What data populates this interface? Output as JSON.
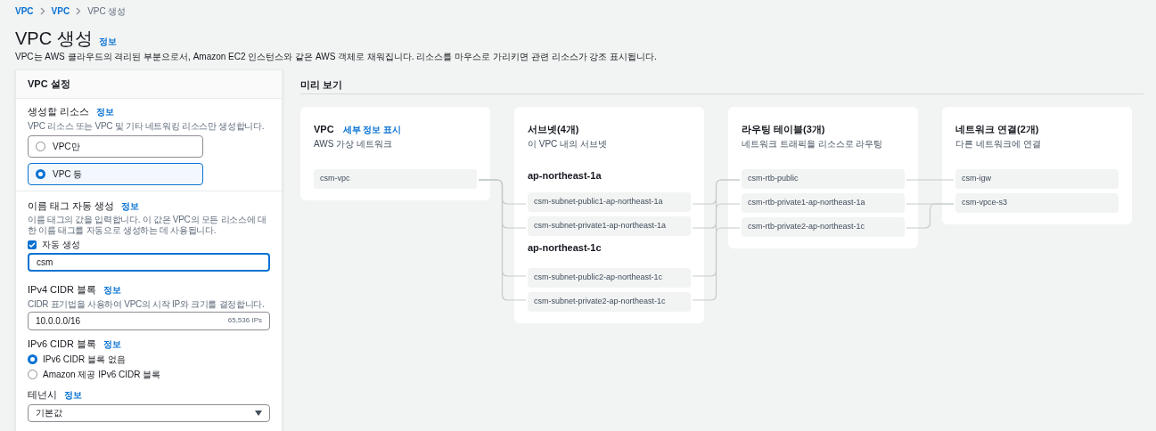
{
  "breadcrumbs": [
    {
      "label": "VPC",
      "link": true
    },
    {
      "label": "VPC",
      "link": true
    },
    {
      "label": "VPC 생성",
      "link": false
    }
  ],
  "page": {
    "title": "VPC 생성",
    "info": "정보",
    "description": "VPC는 AWS 클라우드의 격리된 부분으로서, Amazon EC2 인스턴스와 같은 AWS 객체로 채워집니다. 리소스를 마우스로 가리키면 관련 리소스가 강조 표시됩니다."
  },
  "settings": {
    "title": "VPC 설정",
    "sections": [
      {
        "kind": "radio_cards",
        "label": "생성할 리소스",
        "info": "정보",
        "description": "VPC 리소스 또는 VPC 및 기타 네트워킹 리소스만 생성합니다.",
        "options": [
          {
            "label": "VPC만",
            "selected": false
          },
          {
            "label": "VPC 등",
            "selected": true
          }
        ]
      },
      {
        "kind": "name_tag",
        "label": "이름 태그 자동 생성",
        "info": "정보",
        "description": "이름 태그의 값을 입력합니다. 이 값은 VPC의 모든 리소스에 대한 이름 태그를 자동으로 생성하는 데 사용됩니다.",
        "checkbox": {
          "label": "자동 생성",
          "checked": true
        },
        "value": "csm",
        "focused": true
      },
      {
        "kind": "cidr",
        "label": "IPv4 CIDR 블록",
        "info": "정보",
        "description": "CIDR 표기법을 사용하여 VPC의 시작 IP와 크기를 결정합니다.",
        "value": "10.0.0.0/16",
        "suffix": "65,536 IPs"
      },
      {
        "kind": "radio_list",
        "label": "IPv6 CIDR 블록",
        "info": "정보",
        "options": [
          {
            "label": "IPv6 CIDR 블록 없음",
            "selected": true
          },
          {
            "label": "Amazon 제공 IPv6 CIDR 블록",
            "selected": false
          }
        ]
      },
      {
        "kind": "select",
        "label": "테넌시",
        "info": "정보",
        "value": "기본값"
      }
    ]
  },
  "preview": {
    "title": "미리 보기",
    "cards": [
      {
        "title": "VPC",
        "link": "세부 정보 표시",
        "subtitle": "AWS 가상 네트워크",
        "groups": [
          {
            "items": [
              "csm-vpc"
            ]
          }
        ]
      },
      {
        "title": "서브넷(4개)",
        "subtitle": "이 VPC 내의 서브넷",
        "groups": [
          {
            "heading": "ap-northeast-1a",
            "items": [
              "csm-subnet-public1-ap-northeast-1a",
              "csm-subnet-private1-ap-northeast-1a"
            ]
          },
          {
            "heading": "ap-northeast-1c",
            "items": [
              "csm-subnet-public2-ap-northeast-1c",
              "csm-subnet-private2-ap-northeast-1c"
            ]
          }
        ]
      },
      {
        "title": "라우팅 테이블(3개)",
        "subtitle": "네트워크 트래픽을 리소스로 라우팅",
        "groups": [
          {
            "items": [
              "csm-rtb-public",
              "csm-rtb-private1-ap-northeast-1a",
              "csm-rtb-private2-ap-northeast-1c"
            ]
          }
        ]
      },
      {
        "title": "네트워크 연결(2개)",
        "subtitle": "다른 네트워크에 연결",
        "groups": [
          {
            "items": [
              "csm-igw",
              "csm-vpce-s3"
            ]
          }
        ]
      }
    ]
  }
}
